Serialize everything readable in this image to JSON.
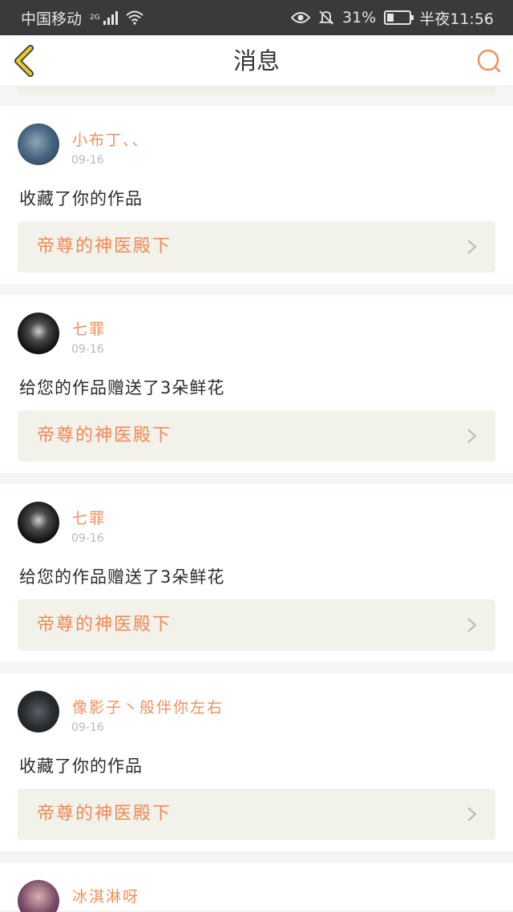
{
  "status_bar": {
    "carrier": "中国移动",
    "network": "2G",
    "battery_percent": "31%",
    "battery_level": 0.31,
    "time": "半夜11:56"
  },
  "nav": {
    "title": "消息",
    "back_icon": "chevron-left-icon",
    "search_icon": "search-icon"
  },
  "colors": {
    "accent": "#f0905c",
    "back_arrow": "#e8c62e",
    "work_box_bg": "#f2f1ea"
  },
  "messages": [
    {
      "user": "小布丁、、",
      "date": "09-16",
      "action": "收藏了你的作品",
      "work": "帝尊的神医殿下"
    },
    {
      "user": "七罪",
      "date": "09-16",
      "action": "给您的作品赠送了3朵鲜花",
      "work": "帝尊的神医殿下"
    },
    {
      "user": "七罪",
      "date": "09-16",
      "action": "给您的作品赠送了3朵鲜花",
      "work": "帝尊的神医殿下"
    },
    {
      "user": "像影子丶般伴你左右",
      "date": "09-16",
      "action": "收藏了你的作品",
      "work": "帝尊的神医殿下"
    },
    {
      "user": "冰淇淋呀"
    }
  ]
}
